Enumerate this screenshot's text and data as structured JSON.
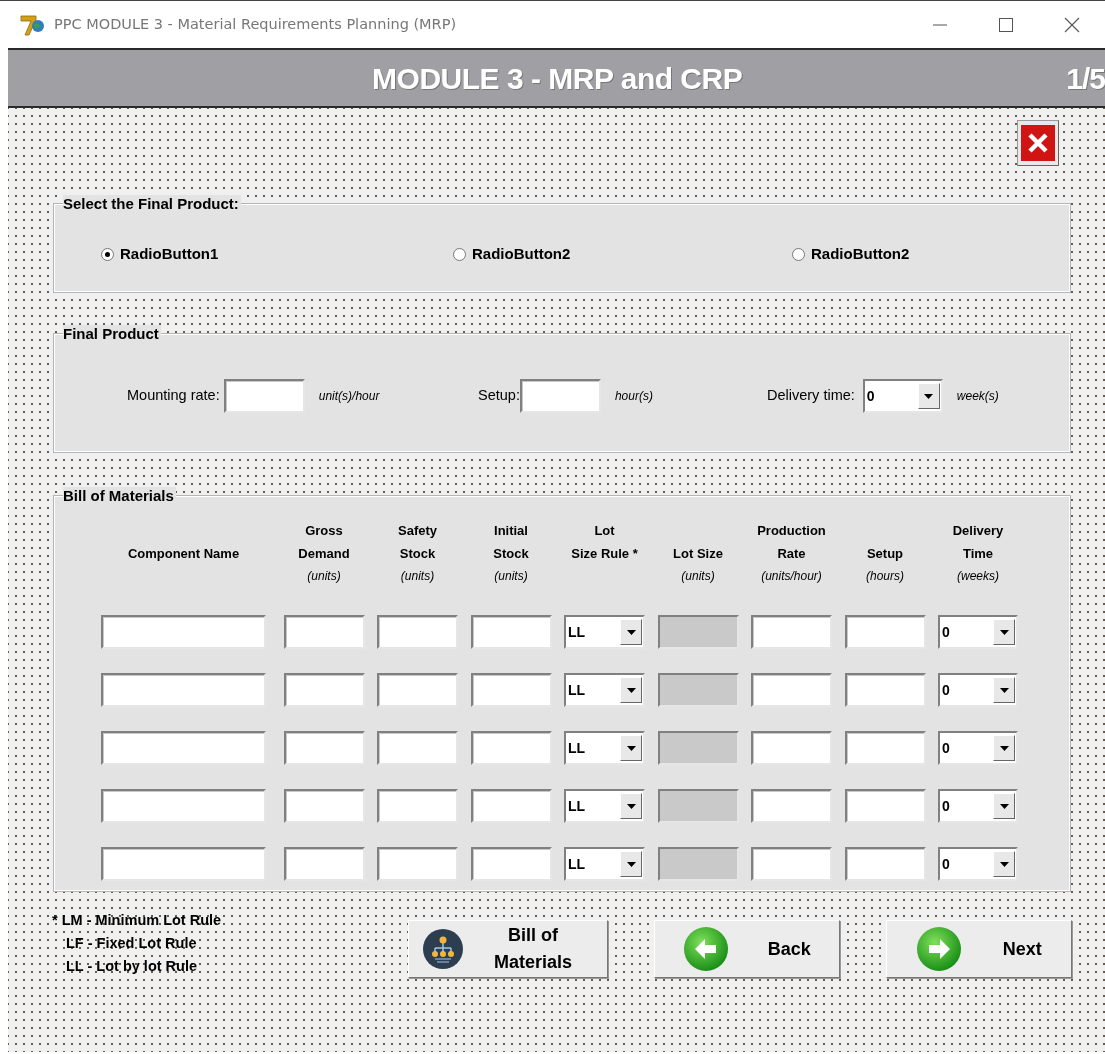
{
  "window": {
    "title": "PPC MODULE 3 - Material Requirements Planning (MRP)"
  },
  "header": {
    "title": "MODULE 3 - MRP and CRP",
    "page": "1/5"
  },
  "product_select": {
    "legend": "Select the Final Product:",
    "options": [
      {
        "label": "RadioButton1",
        "selected": true
      },
      {
        "label": "RadioButton2",
        "selected": false
      },
      {
        "label": "RadioButton2",
        "selected": false
      }
    ]
  },
  "final_product": {
    "legend": "Final Product",
    "fields": [
      {
        "kind": "text",
        "label": "Mounting rate:",
        "unit": "unit(s)/hour"
      },
      {
        "kind": "text",
        "label": "Setup:",
        "unit": "hour(s)"
      },
      {
        "kind": "select",
        "label": "Delivery time:",
        "value": "0",
        "unit": "week(s)"
      }
    ]
  },
  "bom": {
    "legend": "Bill of Materials",
    "columns": [
      {
        "kind": "text",
        "title_lines": [
          "Component Name"
        ]
      },
      {
        "kind": "text",
        "title_lines": [
          "Gross",
          "Demand"
        ],
        "unit": "(units)"
      },
      {
        "kind": "text",
        "title_lines": [
          "Safety",
          "Stock"
        ],
        "unit": "(units)"
      },
      {
        "kind": "text",
        "title_lines": [
          "Initial",
          "Stock"
        ],
        "unit": "(units)"
      },
      {
        "kind": "rule_select",
        "title_lines": [
          "Lot",
          "Size Rule *"
        ]
      },
      {
        "kind": "readonly",
        "title_lines": [
          "Lot Size"
        ],
        "unit": "(units)"
      },
      {
        "kind": "text",
        "title_lines": [
          "Production",
          "Rate"
        ],
        "unit": "(units/hour)"
      },
      {
        "kind": "text",
        "title_lines": [
          "Setup"
        ],
        "unit": "(hours)"
      },
      {
        "kind": "delivery_select",
        "title_lines": [
          "Delivery",
          "Time"
        ],
        "unit": "(weeks)"
      }
    ],
    "rows": [
      {
        "lot_size_rule": "LL",
        "delivery_time": "0"
      },
      {
        "lot_size_rule": "LL",
        "delivery_time": "0"
      },
      {
        "lot_size_rule": "LL",
        "delivery_time": "0"
      },
      {
        "lot_size_rule": "LL",
        "delivery_time": "0"
      },
      {
        "lot_size_rule": "LL",
        "delivery_time": "0"
      }
    ]
  },
  "legend_notes": [
    "* LM - Minimum Lot Rule",
    "LF - Fixed Lot Rule",
    "LL - Lot by lot Rule"
  ],
  "buttons": [
    {
      "kind": "bom",
      "label": "Bill of Materials"
    },
    {
      "kind": "back",
      "label": "Back"
    },
    {
      "kind": "next",
      "label": "Next"
    }
  ]
}
